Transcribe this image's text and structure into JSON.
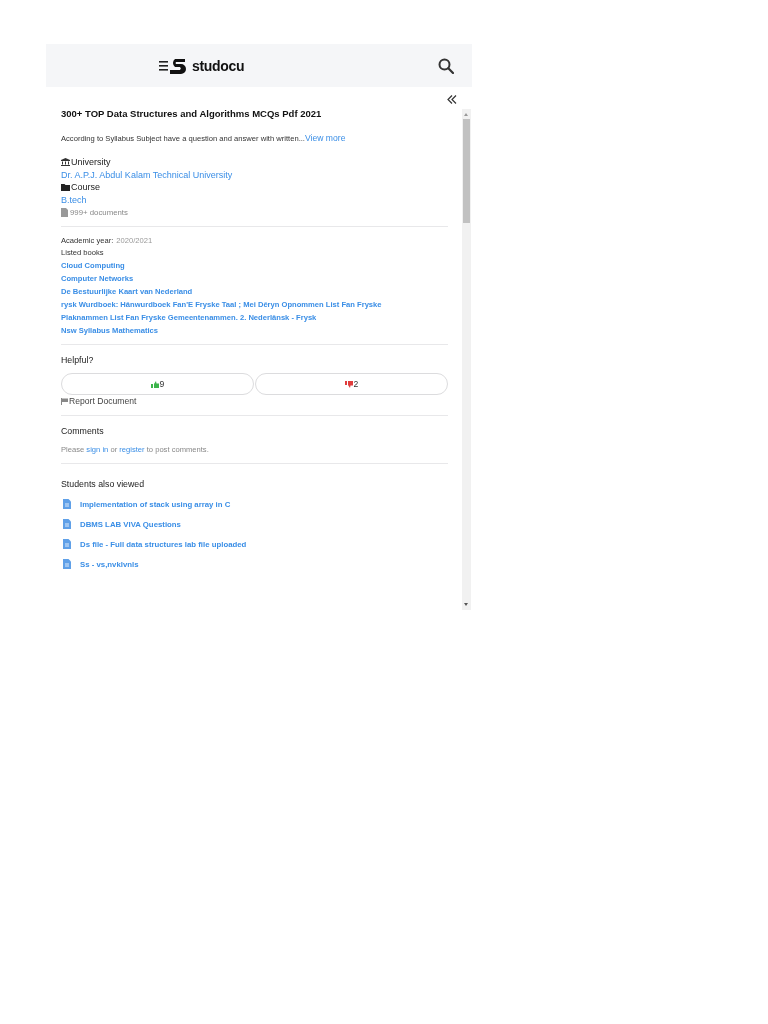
{
  "header": {
    "logo": "studocu"
  },
  "document": {
    "title": "300+ TOP Data Structures and Algorithms MCQs Pdf 2021",
    "description": "According to Syllabus Subject have a question and answer with written...",
    "view_more": "View more",
    "university_label": "University",
    "university": "Dr. A.P.J. Abdul Kalam Technical University",
    "course_label": "Course",
    "course": "B.tech",
    "documents_count": "999+ documents"
  },
  "details": {
    "academic_year_label": "Academic year:",
    "academic_year": "2020/2021",
    "listed_books_label": "Listed books",
    "books": [
      "Cloud Computing",
      "Computer Networks",
      "De Bestuurlijke Kaart van Nederland",
      "rysk Wurdboek: Hânwurdboek Fan'E Fryske Taal ; Mei Dêryn Opnommen List Fan Fryske",
      "Plaknammen List Fan Fryske Gemeentenammen. 2. Nederlânsk - Frysk",
      "Nsw Syllabus Mathematics"
    ]
  },
  "helpful": {
    "title": "Helpful?",
    "votes": [
      {
        "kind": "up",
        "count": "9"
      },
      {
        "kind": "down",
        "count": "2"
      }
    ],
    "report": "Report Document"
  },
  "comments": {
    "title": "Comments",
    "prefix": "Please",
    "sign_in": "sign in",
    "middle": "or",
    "register": "register",
    "suffix": "to post comments."
  },
  "also_viewed": {
    "title": "Students also viewed",
    "items": [
      "Implementation of stack using array in C",
      "DBMS LAB VIVA Questions",
      "Ds file - Full data structures lab file uploaded",
      "Ss - vs,nvklvnls"
    ]
  }
}
